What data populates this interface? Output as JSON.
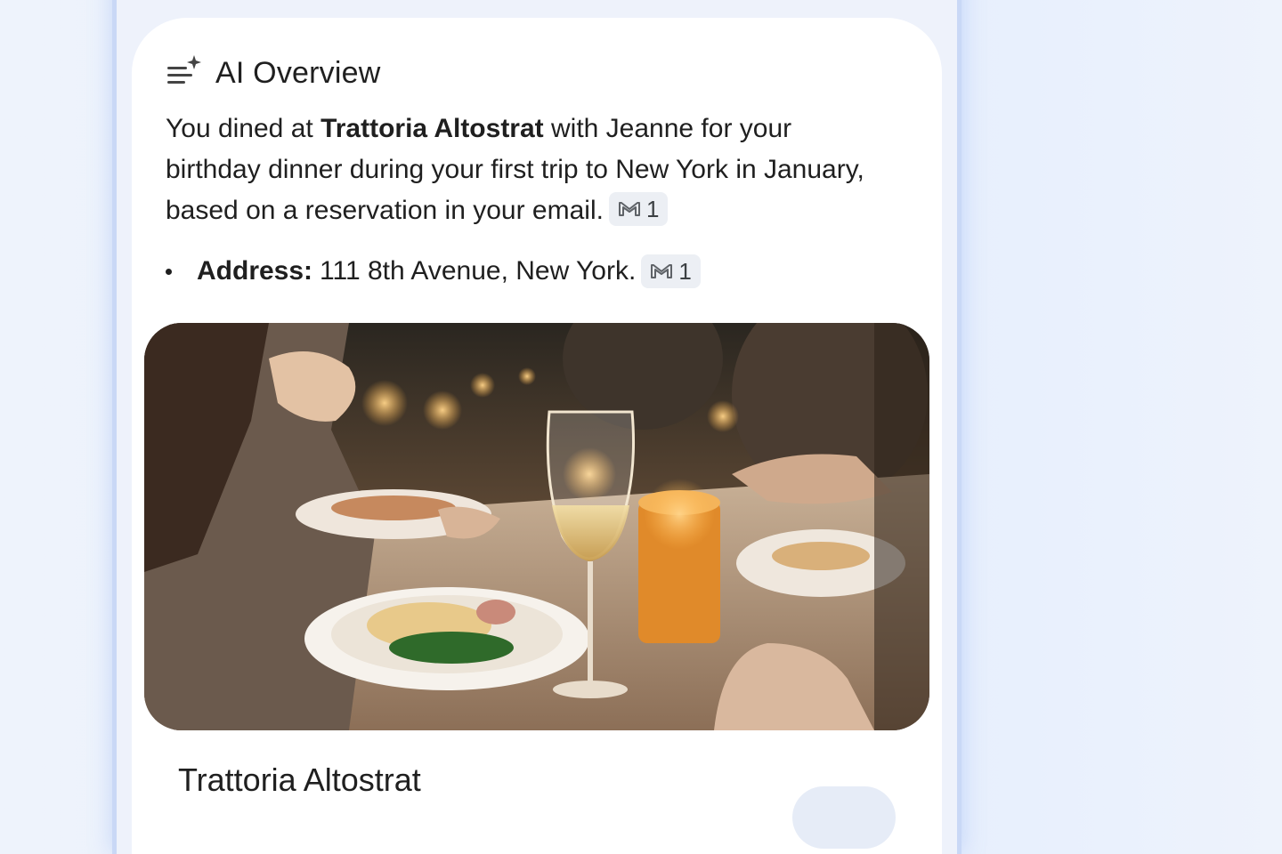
{
  "overview": {
    "title": "AI Overview",
    "icon": "ai-overview-sparkle-icon",
    "summary": {
      "part1": "You dined at ",
      "restaurant": "Trattoria Altostrat",
      "part2": " with Jeanne for your birthday dinner during your first trip to New York in January, based on a reservation in your email.",
      "source_count": "1",
      "source_icon": "gmail-icon"
    },
    "address": {
      "label": "Address:",
      "value": " 111 8th Avenue, New York.",
      "source_count": "1",
      "source_icon": "gmail-icon"
    }
  },
  "place_card": {
    "image": "restaurant-dinner-photo",
    "name": "Trattoria Altostrat"
  },
  "colors": {
    "background": "#eaf1fd",
    "card": "#ffffff",
    "text": "#1f1f1f",
    "chip": "#eceff4",
    "phone_border": "#c9d8f6"
  }
}
